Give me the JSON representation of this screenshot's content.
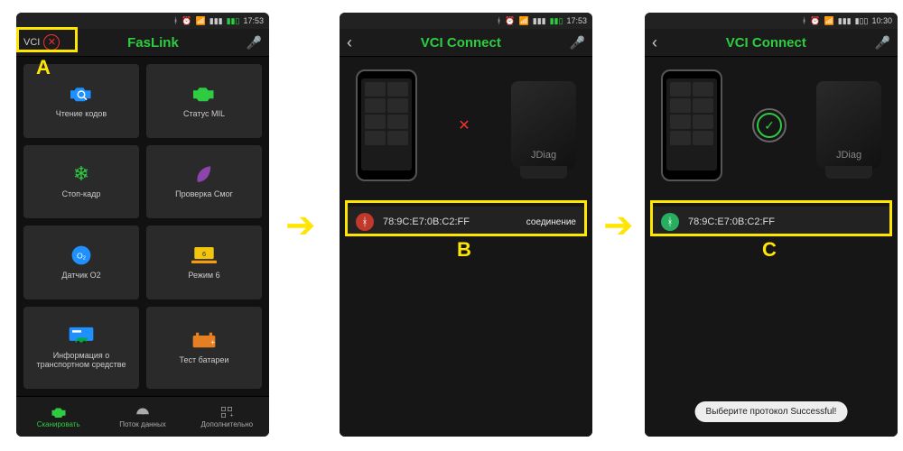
{
  "status": {
    "time_a": "17:53",
    "time_b": "17:53",
    "time_c": "10:30"
  },
  "screenA": {
    "vci_label": "VCI",
    "title": "FasLink",
    "tiles": [
      {
        "label": "Чтение кодов"
      },
      {
        "label": "Статус MIL"
      },
      {
        "label": "Стоп-кадр"
      },
      {
        "label": "Проверка Смог"
      },
      {
        "label": "Датчик O2"
      },
      {
        "label": "Режим 6"
      },
      {
        "label": "Информация о транспортном средстве"
      },
      {
        "label": "Тест батареи"
      }
    ],
    "nav": [
      {
        "label": "Сканировать"
      },
      {
        "label": "Поток данных"
      },
      {
        "label": "Дополнительно"
      }
    ]
  },
  "screenB": {
    "title": "VCI Connect",
    "device_brand": "JDiag",
    "mac": "78:9C:E7:0B:C2:FF",
    "action": "соединение"
  },
  "screenC": {
    "title": "VCI Connect",
    "device_brand": "JDiag",
    "mac": "78:9C:E7:0B:C2:FF",
    "toast": "Выберите протокол Successful!"
  },
  "callouts": {
    "a": "A",
    "b": "B",
    "c": "C"
  }
}
